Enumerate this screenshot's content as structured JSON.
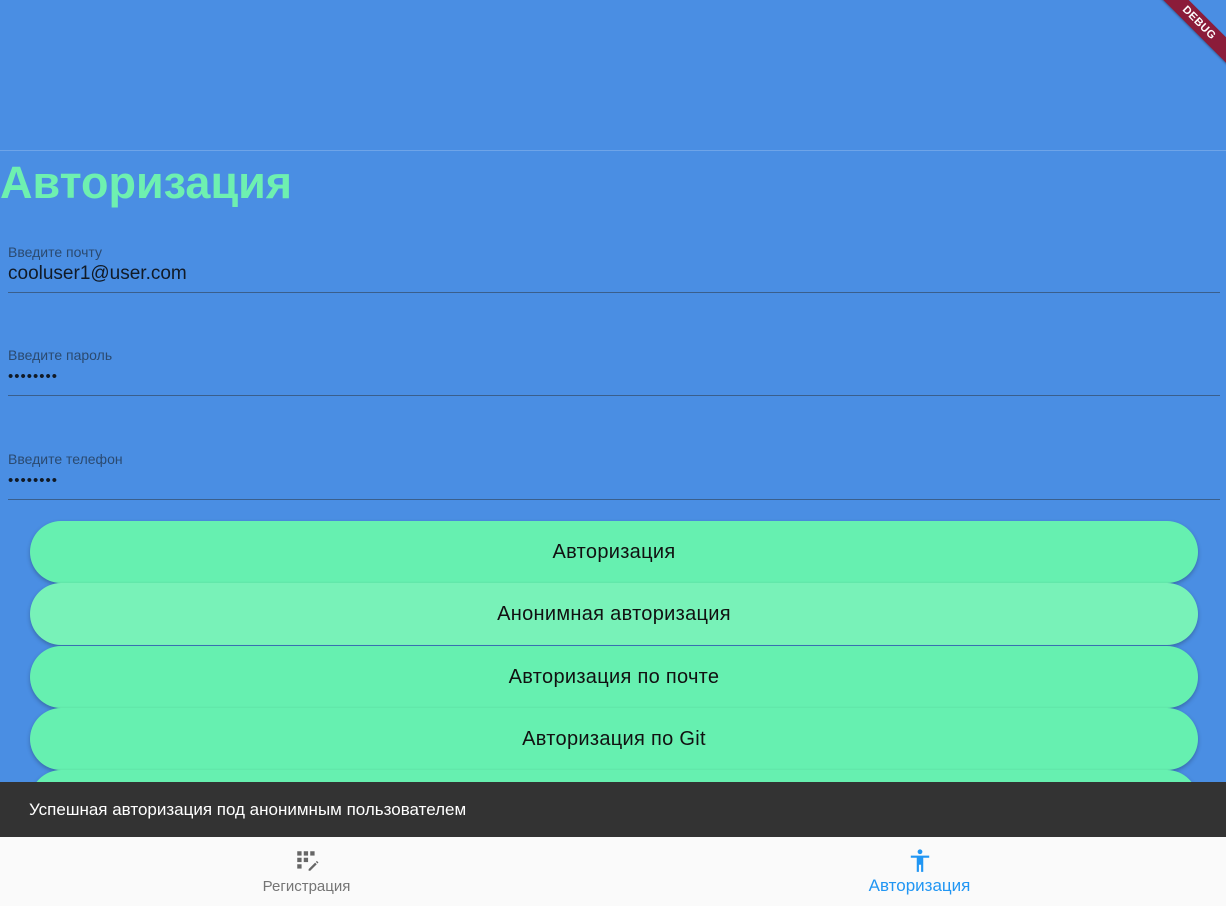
{
  "debug_banner": "DEBUG",
  "page_title": "Авторизация",
  "fields": [
    {
      "label": "Введите почту",
      "value": "cooluser1@user.com"
    },
    {
      "label": "Введите пароль",
      "value": "••••••••"
    },
    {
      "label": "Введите телефон",
      "value": "••••••••"
    }
  ],
  "buttons": [
    "Авторизация",
    "Анонимная авторизация",
    "Авторизация по почте",
    "Авторизация по Git"
  ],
  "snackbar": "Успешная авторизация под анонимным пользователем",
  "bottom_nav": {
    "items": [
      {
        "label": "Регистрация",
        "icon": "app-registration-icon",
        "active": false
      },
      {
        "label": "Авторизация",
        "icon": "accessibility-icon",
        "active": true
      }
    ]
  },
  "colors": {
    "background": "#4a8ee3",
    "title": "#6ef0b0",
    "button": "#66f0b0",
    "snackbar": "#333333",
    "nav_active": "#2196f3",
    "nav_inactive": "#757575",
    "debug_banner": "#8b1c3a"
  }
}
